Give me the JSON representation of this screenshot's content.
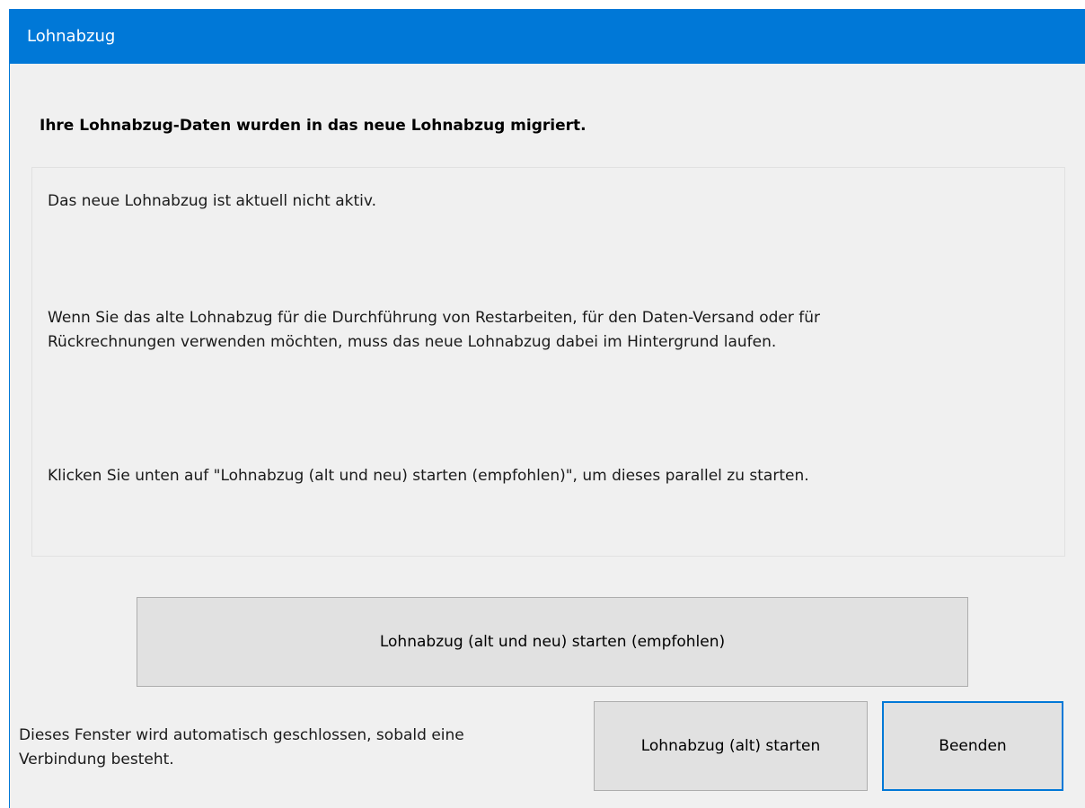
{
  "window": {
    "title": "Lohnabzug"
  },
  "dialog": {
    "heading": "Ihre Lohnabzug-Daten wurden in das neue Lohnabzug migriert.",
    "message": {
      "line1": "Das neue Lohnabzug ist aktuell nicht aktiv.",
      "line2a": "Wenn Sie das alte Lohnabzug für die Durchführung von Restarbeiten, für den Daten-Versand oder für",
      "line2b": "Rückrechnungen verwenden möchten, muss das neue Lohnabzug dabei im Hintergrund laufen.",
      "line3": "Klicken Sie unten auf \"Lohnabzug (alt und neu) starten (empfohlen)\", um dieses parallel zu starten."
    },
    "buttons": {
      "start_both": "Lohnabzug (alt und neu) starten (empfohlen)",
      "start_old": "Lohnabzug (alt) starten",
      "quit": "Beenden"
    },
    "footer": {
      "line1": "Dieses Fenster wird automatisch geschlossen, sobald eine",
      "line2": "Verbindung besteht."
    }
  },
  "colors": {
    "titlebar": "#0078d7",
    "window_background": "#f0f0f0",
    "button_background": "#e1e1e1",
    "focus_border": "#0078d7"
  }
}
